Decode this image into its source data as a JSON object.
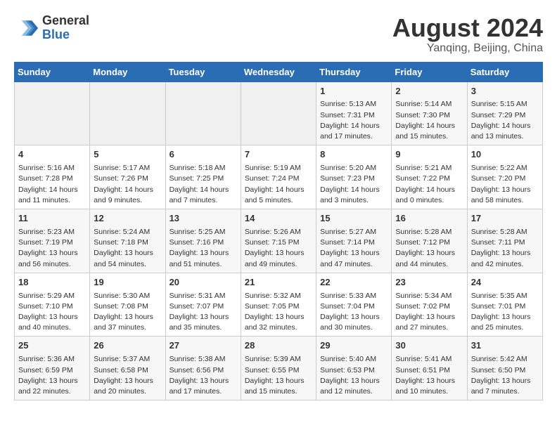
{
  "header": {
    "logo_general": "General",
    "logo_blue": "Blue",
    "month_year": "August 2024",
    "location": "Yanqing, Beijing, China"
  },
  "days_of_week": [
    "Sunday",
    "Monday",
    "Tuesday",
    "Wednesday",
    "Thursday",
    "Friday",
    "Saturday"
  ],
  "weeks": [
    [
      {
        "day": "",
        "data": ""
      },
      {
        "day": "",
        "data": ""
      },
      {
        "day": "",
        "data": ""
      },
      {
        "day": "",
        "data": ""
      },
      {
        "day": "1",
        "data": "Sunrise: 5:13 AM\nSunset: 7:31 PM\nDaylight: 14 hours\nand 17 minutes."
      },
      {
        "day": "2",
        "data": "Sunrise: 5:14 AM\nSunset: 7:30 PM\nDaylight: 14 hours\nand 15 minutes."
      },
      {
        "day": "3",
        "data": "Sunrise: 5:15 AM\nSunset: 7:29 PM\nDaylight: 14 hours\nand 13 minutes."
      }
    ],
    [
      {
        "day": "4",
        "data": "Sunrise: 5:16 AM\nSunset: 7:28 PM\nDaylight: 14 hours\nand 11 minutes."
      },
      {
        "day": "5",
        "data": "Sunrise: 5:17 AM\nSunset: 7:26 PM\nDaylight: 14 hours\nand 9 minutes."
      },
      {
        "day": "6",
        "data": "Sunrise: 5:18 AM\nSunset: 7:25 PM\nDaylight: 14 hours\nand 7 minutes."
      },
      {
        "day": "7",
        "data": "Sunrise: 5:19 AM\nSunset: 7:24 PM\nDaylight: 14 hours\nand 5 minutes."
      },
      {
        "day": "8",
        "data": "Sunrise: 5:20 AM\nSunset: 7:23 PM\nDaylight: 14 hours\nand 3 minutes."
      },
      {
        "day": "9",
        "data": "Sunrise: 5:21 AM\nSunset: 7:22 PM\nDaylight: 14 hours\nand 0 minutes."
      },
      {
        "day": "10",
        "data": "Sunrise: 5:22 AM\nSunset: 7:20 PM\nDaylight: 13 hours\nand 58 minutes."
      }
    ],
    [
      {
        "day": "11",
        "data": "Sunrise: 5:23 AM\nSunset: 7:19 PM\nDaylight: 13 hours\nand 56 minutes."
      },
      {
        "day": "12",
        "data": "Sunrise: 5:24 AM\nSunset: 7:18 PM\nDaylight: 13 hours\nand 54 minutes."
      },
      {
        "day": "13",
        "data": "Sunrise: 5:25 AM\nSunset: 7:16 PM\nDaylight: 13 hours\nand 51 minutes."
      },
      {
        "day": "14",
        "data": "Sunrise: 5:26 AM\nSunset: 7:15 PM\nDaylight: 13 hours\nand 49 minutes."
      },
      {
        "day": "15",
        "data": "Sunrise: 5:27 AM\nSunset: 7:14 PM\nDaylight: 13 hours\nand 47 minutes."
      },
      {
        "day": "16",
        "data": "Sunrise: 5:28 AM\nSunset: 7:12 PM\nDaylight: 13 hours\nand 44 minutes."
      },
      {
        "day": "17",
        "data": "Sunrise: 5:28 AM\nSunset: 7:11 PM\nDaylight: 13 hours\nand 42 minutes."
      }
    ],
    [
      {
        "day": "18",
        "data": "Sunrise: 5:29 AM\nSunset: 7:10 PM\nDaylight: 13 hours\nand 40 minutes."
      },
      {
        "day": "19",
        "data": "Sunrise: 5:30 AM\nSunset: 7:08 PM\nDaylight: 13 hours\nand 37 minutes."
      },
      {
        "day": "20",
        "data": "Sunrise: 5:31 AM\nSunset: 7:07 PM\nDaylight: 13 hours\nand 35 minutes."
      },
      {
        "day": "21",
        "data": "Sunrise: 5:32 AM\nSunset: 7:05 PM\nDaylight: 13 hours\nand 32 minutes."
      },
      {
        "day": "22",
        "data": "Sunrise: 5:33 AM\nSunset: 7:04 PM\nDaylight: 13 hours\nand 30 minutes."
      },
      {
        "day": "23",
        "data": "Sunrise: 5:34 AM\nSunset: 7:02 PM\nDaylight: 13 hours\nand 27 minutes."
      },
      {
        "day": "24",
        "data": "Sunrise: 5:35 AM\nSunset: 7:01 PM\nDaylight: 13 hours\nand 25 minutes."
      }
    ],
    [
      {
        "day": "25",
        "data": "Sunrise: 5:36 AM\nSunset: 6:59 PM\nDaylight: 13 hours\nand 22 minutes."
      },
      {
        "day": "26",
        "data": "Sunrise: 5:37 AM\nSunset: 6:58 PM\nDaylight: 13 hours\nand 20 minutes."
      },
      {
        "day": "27",
        "data": "Sunrise: 5:38 AM\nSunset: 6:56 PM\nDaylight: 13 hours\nand 17 minutes."
      },
      {
        "day": "28",
        "data": "Sunrise: 5:39 AM\nSunset: 6:55 PM\nDaylight: 13 hours\nand 15 minutes."
      },
      {
        "day": "29",
        "data": "Sunrise: 5:40 AM\nSunset: 6:53 PM\nDaylight: 13 hours\nand 12 minutes."
      },
      {
        "day": "30",
        "data": "Sunrise: 5:41 AM\nSunset: 6:51 PM\nDaylight: 13 hours\nand 10 minutes."
      },
      {
        "day": "31",
        "data": "Sunrise: 5:42 AM\nSunset: 6:50 PM\nDaylight: 13 hours\nand 7 minutes."
      }
    ]
  ]
}
